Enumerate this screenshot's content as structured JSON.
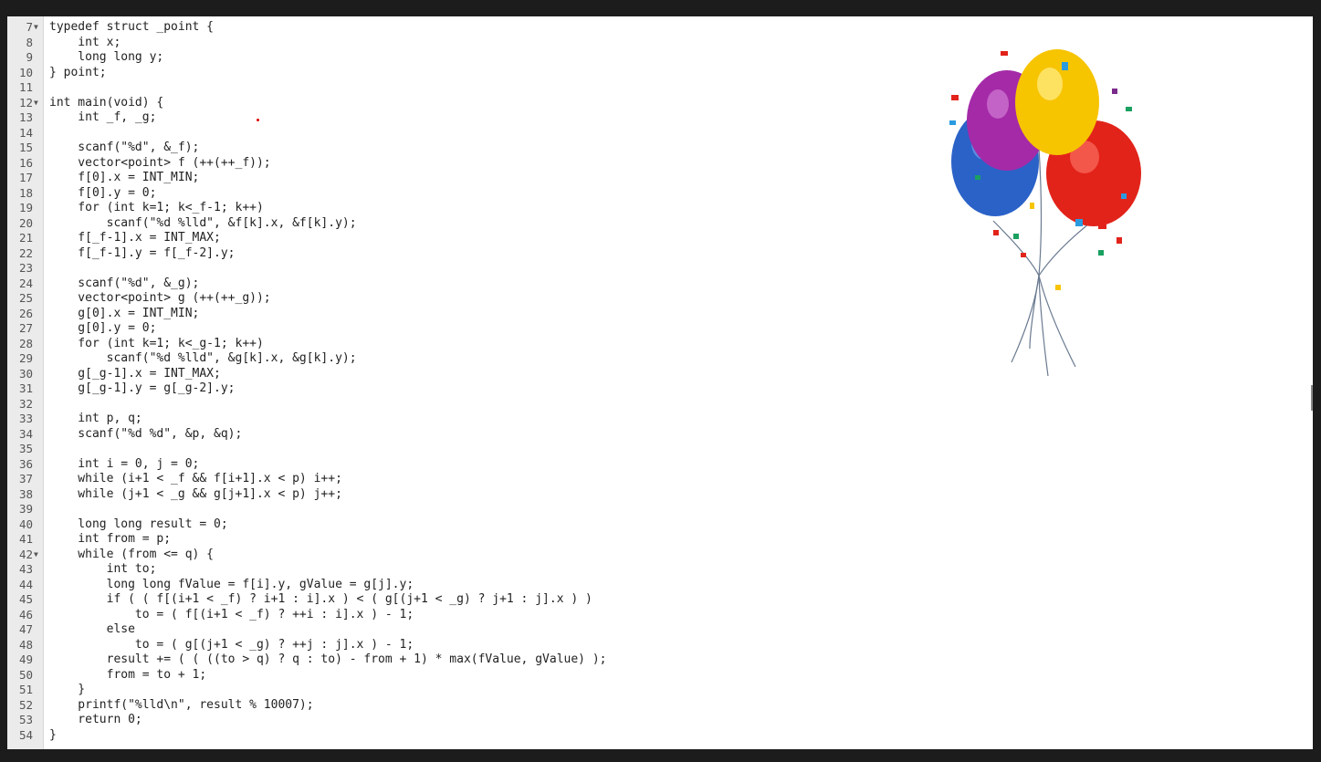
{
  "editor": {
    "lines": [
      {
        "n": "7",
        "fold": true,
        "text": "typedef struct _point {"
      },
      {
        "n": "8",
        "text": "    int x;"
      },
      {
        "n": "9",
        "text": "    long long y;"
      },
      {
        "n": "10",
        "text": "} point;"
      },
      {
        "n": "11",
        "text": ""
      },
      {
        "n": "12",
        "fold": true,
        "text": "int main(void) {"
      },
      {
        "n": "13",
        "text": "    int _f, _g;"
      },
      {
        "n": "14",
        "text": ""
      },
      {
        "n": "15",
        "text": "    scanf(\"%d\", &_f);"
      },
      {
        "n": "16",
        "text": "    vector<point> f (++(++_f));"
      },
      {
        "n": "17",
        "text": "    f[0].x = INT_MIN;"
      },
      {
        "n": "18",
        "text": "    f[0].y = 0;"
      },
      {
        "n": "19",
        "text": "    for (int k=1; k<_f-1; k++)"
      },
      {
        "n": "20",
        "text": "        scanf(\"%d %lld\", &f[k].x, &f[k].y);"
      },
      {
        "n": "21",
        "text": "    f[_f-1].x = INT_MAX;"
      },
      {
        "n": "22",
        "text": "    f[_f-1].y = f[_f-2].y;"
      },
      {
        "n": "23",
        "text": ""
      },
      {
        "n": "24",
        "text": "    scanf(\"%d\", &_g);"
      },
      {
        "n": "25",
        "text": "    vector<point> g (++(++_g));"
      },
      {
        "n": "26",
        "text": "    g[0].x = INT_MIN;"
      },
      {
        "n": "27",
        "text": "    g[0].y = 0;"
      },
      {
        "n": "28",
        "text": "    for (int k=1; k<_g-1; k++)"
      },
      {
        "n": "29",
        "text": "        scanf(\"%d %lld\", &g[k].x, &g[k].y);"
      },
      {
        "n": "30",
        "text": "    g[_g-1].x = INT_MAX;"
      },
      {
        "n": "31",
        "text": "    g[_g-1].y = g[_g-2].y;"
      },
      {
        "n": "32",
        "text": ""
      },
      {
        "n": "33",
        "text": "    int p, q;"
      },
      {
        "n": "34",
        "text": "    scanf(\"%d %d\", &p, &q);"
      },
      {
        "n": "35",
        "text": ""
      },
      {
        "n": "36",
        "text": "    int i = 0, j = 0;"
      },
      {
        "n": "37",
        "text": "    while (i+1 < _f && f[i+1].x < p) i++;"
      },
      {
        "n": "38",
        "text": "    while (j+1 < _g && g[j+1].x < p) j++;"
      },
      {
        "n": "39",
        "text": ""
      },
      {
        "n": "40",
        "text": "    long long result = 0;"
      },
      {
        "n": "41",
        "text": "    int from = p;"
      },
      {
        "n": "42",
        "fold": true,
        "text": "    while (from <= q) {"
      },
      {
        "n": "43",
        "text": "        int to;"
      },
      {
        "n": "44",
        "text": "        long long fValue = f[i].y, gValue = g[j].y;"
      },
      {
        "n": "45",
        "text": "        if ( ( f[(i+1 < _f) ? i+1 : i].x ) < ( g[(j+1 < _g) ? j+1 : j].x ) )"
      },
      {
        "n": "46",
        "text": "            to = ( f[(i+1 < _f) ? ++i : i].x ) - 1;"
      },
      {
        "n": "47",
        "text": "        else"
      },
      {
        "n": "48",
        "text": "            to = ( g[(j+1 < _g) ? ++j : j].x ) - 1;"
      },
      {
        "n": "49",
        "text": "        result += ( ( ((to > q) ? q : to) - from + 1) * max(fValue, gValue) );"
      },
      {
        "n": "50",
        "text": "        from = to + 1;"
      },
      {
        "n": "51",
        "text": "    }"
      },
      {
        "n": "52",
        "text": "    printf(\"%lld\\n\", result % 10007);"
      },
      {
        "n": "53",
        "text": "    return 0;"
      },
      {
        "n": "54",
        "text": "}"
      }
    ]
  },
  "decoration": {
    "icon": "balloons-icon"
  },
  "colors": {
    "background": "#1c1c1c",
    "editor_bg": "#ffffff",
    "gutter_bg": "#ebebeb",
    "keyword": "#7a2a8a"
  }
}
